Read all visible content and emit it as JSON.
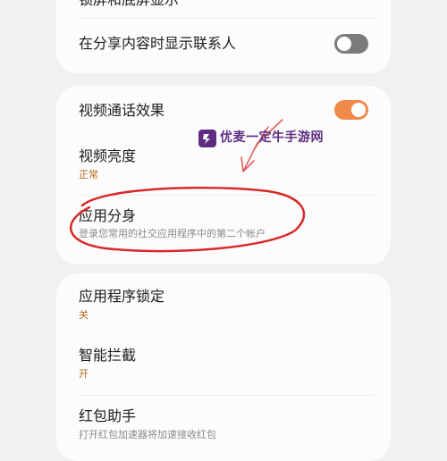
{
  "settings": {
    "card1": {
      "partial_label": "锁屏和底屏显示",
      "share_contacts": {
        "label": "在分享内容时显示联系人",
        "toggle": "off"
      }
    },
    "card2": {
      "video_call_effects": {
        "label": "视频通话效果",
        "toggle": "on"
      },
      "video_brightness": {
        "label": "视频亮度",
        "value": "正常"
      },
      "dual_apps": {
        "label": "应用分身",
        "desc": "登录您常用的社交应用程序中的第二个帐户"
      }
    },
    "card3": {
      "app_lock": {
        "label": "应用程序锁定",
        "value": "关"
      },
      "smart_intercept": {
        "label": "智能拦截",
        "value": "开"
      },
      "red_packet": {
        "label": "红包助手",
        "desc": "打开红包加速器将加速接收红包"
      }
    }
  },
  "watermark": {
    "text": "优麦一定牛手游网"
  },
  "colors": {
    "accent": "#f08a4b",
    "annotation_red": "#d9292a",
    "watermark": "#5e2c80"
  }
}
